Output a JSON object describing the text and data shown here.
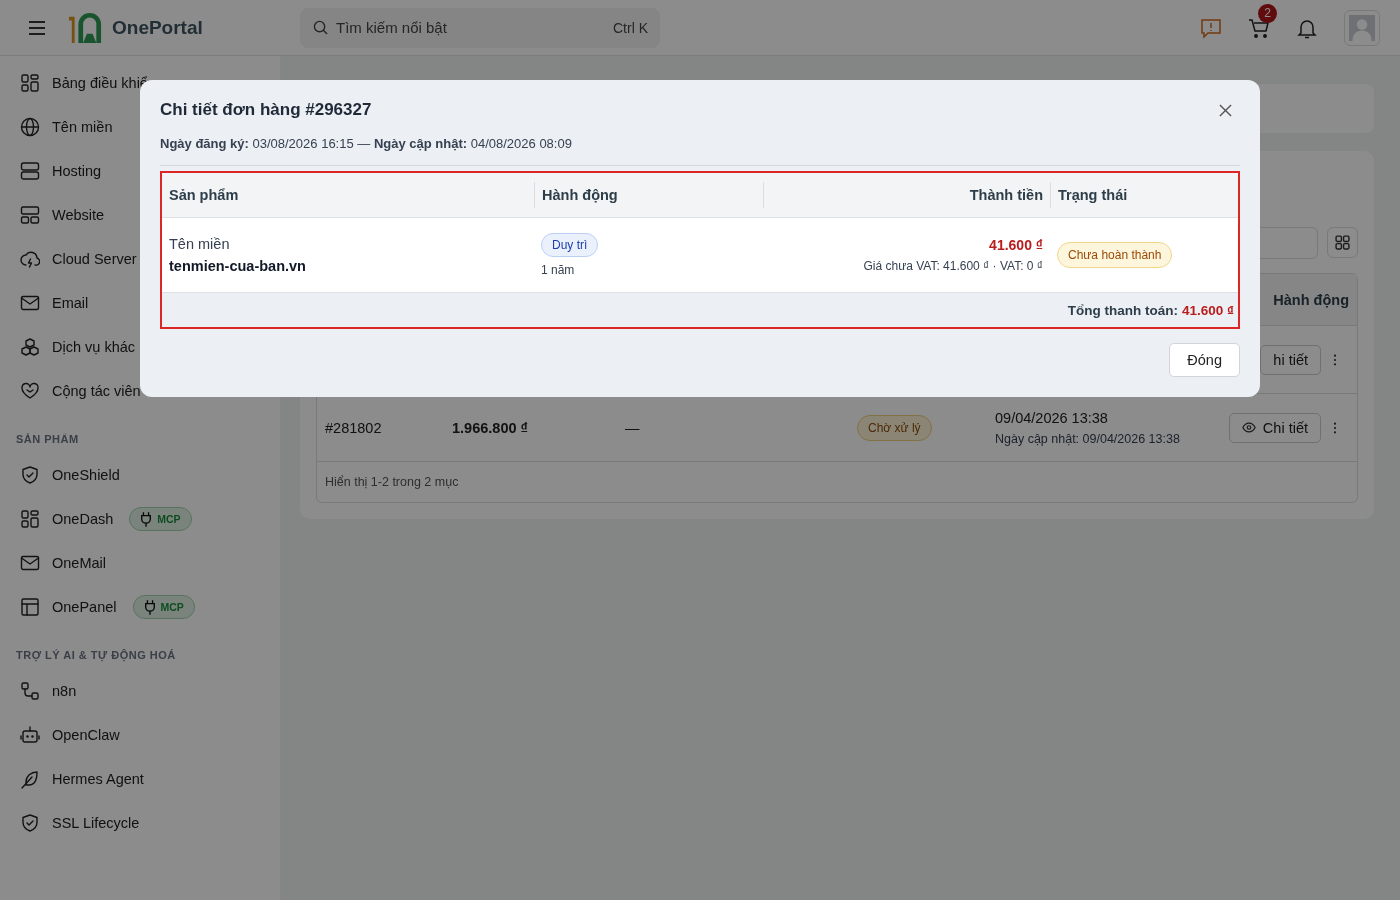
{
  "header": {
    "logo_text": "OnePortal",
    "search": {
      "placeholder": "Tìm kiếm nổi bật",
      "shortcut": "Ctrl K"
    },
    "cart_badge": "2"
  },
  "sidebar": {
    "items": [
      {
        "label": "Bảng điều khiể"
      },
      {
        "label": "Tên miền"
      },
      {
        "label": "Hosting"
      },
      {
        "label": "Website"
      },
      {
        "label": "Cloud Server"
      },
      {
        "label": "Email"
      },
      {
        "label": "Dịch vụ khác"
      },
      {
        "label": "Cộng tác viên"
      }
    ],
    "sections": [
      {
        "title": "SẢN PHẨM",
        "items": [
          {
            "label": "OneShield"
          },
          {
            "label": "OneDash",
            "badge": "MCP"
          },
          {
            "label": "OneMail"
          },
          {
            "label": "OnePanel",
            "badge": "MCP"
          }
        ]
      },
      {
        "title": "TRỢ LÝ AI & TỰ ĐỘNG HOÁ",
        "items": [
          {
            "label": "n8n"
          },
          {
            "label": "OpenClaw"
          },
          {
            "label": "Hermes Agent"
          },
          {
            "label": "SSL Lifecycle"
          }
        ]
      }
    ]
  },
  "main": {
    "table": {
      "columns": [
        "Hành động"
      ],
      "rows": [
        {
          "action": "hi tiết"
        },
        {
          "order": "#281802",
          "amount": "1.966.800 ₫",
          "column_3": "—",
          "status": "Chờ xử lý",
          "date": "09/04/2026 13:38",
          "updated": "Ngày cập nhật: 09/04/2026 13:38",
          "action": "Chi tiết"
        }
      ],
      "footer": "Hiển thị 1-2 trong 2 mục"
    }
  },
  "modal": {
    "title": "Chi tiết đơn hàng #296327",
    "meta": "**Ngày đăng ký:** 03/08/2026 16:15 — **Ngày cập nhật:** 04/08/2026 08:09",
    "columns": [
      "Sản phẩm",
      "Hành động",
      "Thành tiền",
      "Trạng thái"
    ],
    "rows": [
      {
        "product_type": "Tên miền",
        "product_name": "tenmien-cua-ban.vn",
        "action": "Duy trì",
        "period": "1 năm",
        "amount": "41.600 ₫",
        "amount_detail": "Giá chưa VAT: 41.600 ₫ · VAT: 0 ₫",
        "status": "Chưa hoàn thành"
      }
    ],
    "total_label": "Tổng thanh toán:",
    "total_value": "41.600 ₫",
    "close_button": "Đóng"
  }
}
